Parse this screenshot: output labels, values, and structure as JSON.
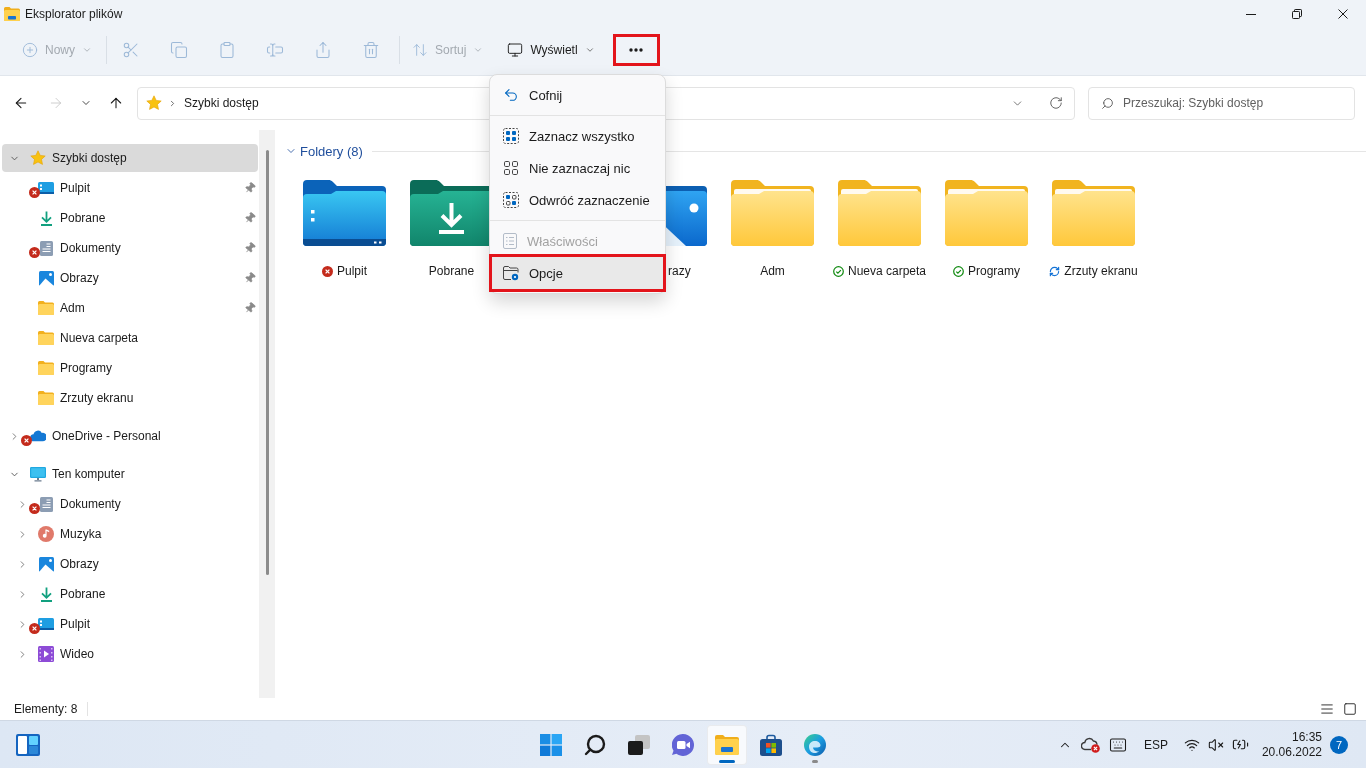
{
  "window": {
    "title": "Eksplorator plików"
  },
  "toolbar": [
    {
      "kind": "button",
      "label": "Nowy",
      "disabled": true,
      "dropdown": true,
      "highlighted": false
    },
    {
      "kind": "separator"
    },
    {
      "kind": "icon",
      "disabled": true,
      "highlighted": false
    },
    {
      "kind": "icon",
      "disabled": true,
      "highlighted": false
    },
    {
      "kind": "icon",
      "disabled": true,
      "highlighted": false
    },
    {
      "kind": "icon",
      "disabled": true,
      "highlighted": false
    },
    {
      "kind": "icon",
      "disabled": true,
      "highlighted": false
    },
    {
      "kind": "icon",
      "disabled": true,
      "highlighted": false
    },
    {
      "kind": "separator"
    },
    {
      "kind": "button",
      "label": "Sortuj",
      "disabled": true,
      "dropdown": true,
      "highlighted": false
    },
    {
      "kind": "button",
      "label": "Wyświetl",
      "disabled": false,
      "dropdown": true,
      "highlighted": false
    },
    {
      "kind": "icon",
      "disabled": false,
      "highlighted": true
    }
  ],
  "navigation": [
    {
      "disabled": false
    },
    {
      "disabled": true
    },
    {
      "disabled": false
    },
    {
      "disabled": false
    }
  ],
  "address": {
    "path": [
      "Szybki dostęp"
    ]
  },
  "search": {
    "placeholder": "Przeszukaj: Szybki dostęp"
  },
  "sidebar": {
    "tree": [
      {
        "label": "Szybki dostęp",
        "kind": "star",
        "expanded": true,
        "selected": true,
        "error": false,
        "children": [
          {
            "label": "Pulpit",
            "kind": "desktop",
            "selected": false,
            "error": true,
            "pinned": true
          },
          {
            "label": "Pobrane",
            "kind": "download",
            "selected": false,
            "error": false,
            "pinned": true
          },
          {
            "label": "Dokumenty",
            "kind": "documents",
            "selected": false,
            "error": true,
            "pinned": true
          },
          {
            "label": "Obrazy",
            "kind": "pictures",
            "selected": false,
            "error": false,
            "pinned": true
          },
          {
            "label": "Adm",
            "kind": "folder",
            "selected": false,
            "error": false,
            "pinned": true
          },
          {
            "label": "Nueva carpeta",
            "kind": "folder",
            "selected": false,
            "error": false,
            "pinned": false
          },
          {
            "label": "Programy",
            "kind": "folder",
            "selected": false,
            "error": false,
            "pinned": false
          },
          {
            "label": "Zrzuty ekranu",
            "kind": "folder",
            "selected": false,
            "error": false,
            "pinned": false
          }
        ]
      },
      {
        "label": "OneDrive - Personal",
        "kind": "cloud",
        "expanded": false,
        "selected": false,
        "error": true
      },
      {
        "label": "Ten komputer",
        "kind": "computer",
        "expanded": true,
        "selected": false,
        "error": false,
        "children": [
          {
            "label": "Dokumenty",
            "kind": "documents",
            "expanded": false,
            "selected": false,
            "error": true
          },
          {
            "label": "Muzyka",
            "kind": "music",
            "expanded": false,
            "selected": false,
            "error": false
          },
          {
            "label": "Obrazy",
            "kind": "pictures",
            "expanded": false,
            "selected": false,
            "error": false
          },
          {
            "label": "Pobrane",
            "kind": "download",
            "expanded": false,
            "selected": false,
            "error": false
          },
          {
            "label": "Pulpit",
            "kind": "desktop",
            "expanded": false,
            "selected": false,
            "error": true
          },
          {
            "label": "Wideo",
            "kind": "video",
            "expanded": false,
            "selected": false,
            "error": false
          }
        ]
      }
    ]
  },
  "content": {
    "section": {
      "title": "Foldery (8)",
      "expanded": true
    },
    "folders": [
      {
        "label": "Pulpit",
        "kind": "desktop",
        "error": true,
        "synced": false,
        "syncing": false
      },
      {
        "label": "Pobrane",
        "kind": "download",
        "error": false,
        "synced": false,
        "syncing": false
      },
      {
        "label": "razy",
        "kind": "pictures",
        "clipped": true,
        "error": false,
        "synced": false,
        "syncing": false
      },
      {
        "label": "Adm",
        "kind": "folder",
        "error": false,
        "synced": false,
        "syncing": false
      },
      {
        "label": "Nueva carpeta",
        "kind": "folder",
        "error": false,
        "synced": true,
        "syncing": false
      },
      {
        "label": "Programy",
        "kind": "folder",
        "error": false,
        "synced": true,
        "syncing": false
      },
      {
        "label": "Zrzuty ekranu",
        "kind": "folder",
        "error": false,
        "synced": false,
        "syncing": true
      }
    ]
  },
  "context_menu": {
    "groups": [
      [
        {
          "label": "Cofnij",
          "disabled": false,
          "hovered": false,
          "highlighted": false
        }
      ],
      [
        {
          "label": "Zaznacz wszystko",
          "disabled": false,
          "hovered": false,
          "highlighted": false
        },
        {
          "label": "Nie zaznaczaj nic",
          "disabled": false,
          "hovered": false,
          "highlighted": false
        },
        {
          "label": "Odwróć zaznaczenie",
          "disabled": false,
          "hovered": false,
          "highlighted": false
        }
      ],
      [
        {
          "label": "Właściwości",
          "disabled": true,
          "hovered": false,
          "highlighted": false
        },
        {
          "label": "Opcje",
          "disabled": false,
          "hovered": true,
          "highlighted": true
        }
      ]
    ]
  },
  "status_bar": {
    "text": "Elementy: 8"
  },
  "taskbar": {
    "apps": [
      {
        "active": false,
        "running": false
      },
      {
        "active": false,
        "running": false
      },
      {
        "active": false,
        "running": false
      },
      {
        "active": false,
        "running": false
      },
      {
        "active": true,
        "running": true
      },
      {
        "active": false,
        "running": false
      },
      {
        "active": false,
        "running": true
      }
    ],
    "tray": {
      "language": "ESP",
      "time": "16:35",
      "date": "20.06.2022",
      "notifications": "7"
    }
  }
}
